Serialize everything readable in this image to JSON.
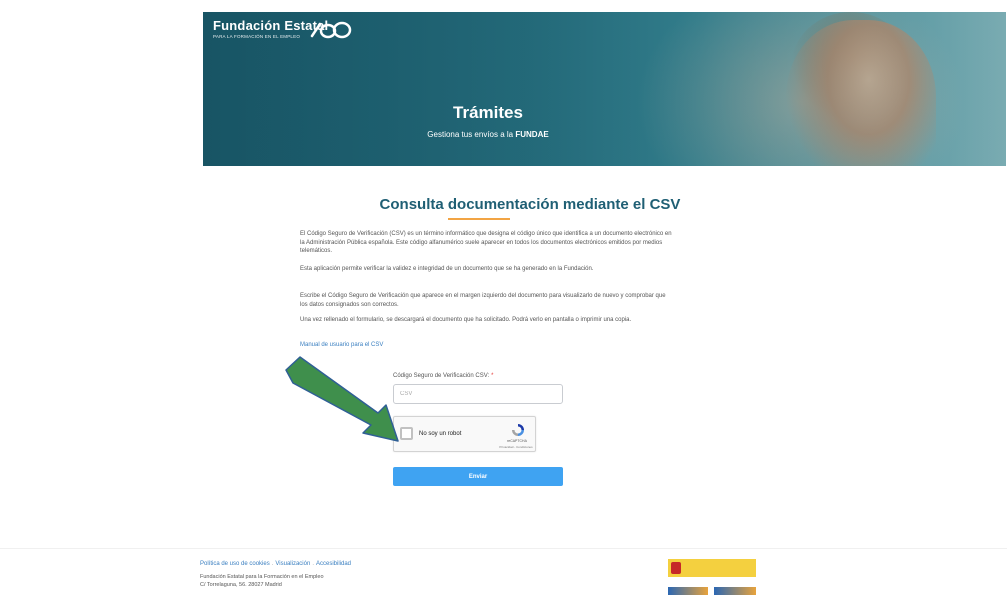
{
  "header": {
    "org_name": "Fundación Estatal",
    "org_subtitle": "PARA LA FORMACIÓN EN EL EMPLEO",
    "title": "Trámites",
    "subtitle_prefix": "Gestiona tus envíos a la ",
    "subtitle_brand": "FUNDAE"
  },
  "main": {
    "title": "Consulta documentación mediante el CSV",
    "paragraphs": [
      "El Código Seguro de Verificación (CSV) es un término informático que designa el código único que identifica a un documento electrónico en la Administración Pública española. Este código alfanumérico suele aparecer en todos los documentos electrónicos emitidos por medios telemáticos.",
      "Esta aplicación permite verificar la validez e integridad de un documento que se ha generado en la Fundación.",
      "Escribe el Código Seguro de Verificación que aparece en el margen izquierdo del documento para visualizarlo de nuevo y comprobar que los datos consignados son correctos.",
      "Una vez rellenado el formulario, se descargará el documento que ha solicitado. Podrá verlo en pantalla o imprimir una copia."
    ],
    "manual_link": "Manual de usuario para el CSV"
  },
  "form": {
    "csv_label": "Código Seguro de Verificación CSV:",
    "required_mark": "*",
    "csv_placeholder": "CSV",
    "captcha_label": "No soy un robot",
    "captcha_brand": "reCAPTCHA",
    "captcha_terms": "Privacidad - Condiciones",
    "submit_label": "Enviar"
  },
  "footer": {
    "link_cookies": "Política de uso de cookies",
    "link_visualizacion": "Visualización",
    "link_accesibilidad": "Accesibilidad",
    "org": "Fundación Estatal para la Formación en el Empleo",
    "address": "C/ Torrelaguna, 56. 28027 Madrid"
  },
  "colors": {
    "title": "#1f5f74",
    "accent_underline": "#f2a444",
    "link": "#3a7fc0",
    "button": "#3fa3f2",
    "annotation_arrow": "#3f8f4c"
  }
}
